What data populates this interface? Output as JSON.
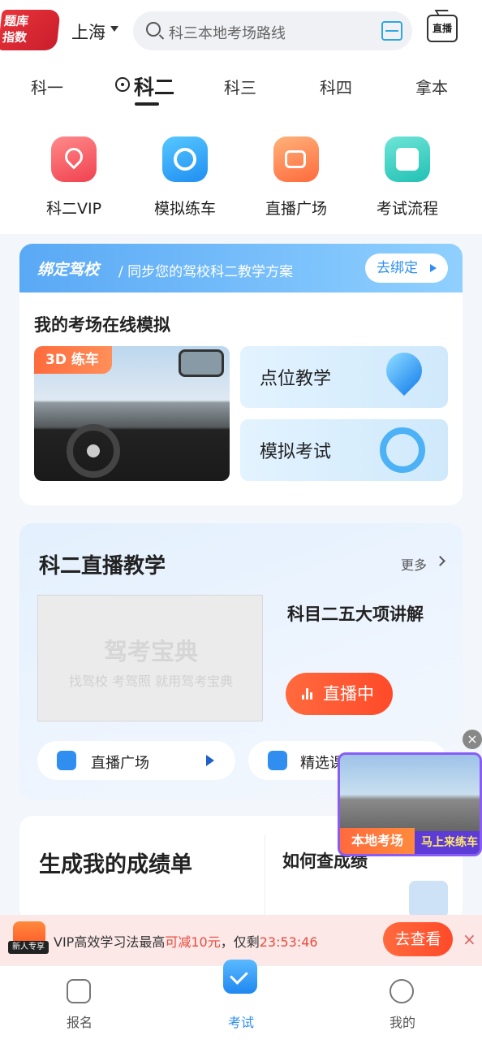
{
  "header": {
    "logo_line1": "题库",
    "logo_line2": "指数",
    "city": "上海",
    "search_placeholder": "科三本地考场路线",
    "live_icon_label": "直播"
  },
  "subject_tabs": [
    "科一",
    "科二",
    "科三",
    "科四",
    "拿本"
  ],
  "active_tab": "科二",
  "quick_entries": [
    {
      "label": "科二VIP",
      "icon": "vip-icon"
    },
    {
      "label": "模拟练车",
      "icon": "steering-wheel-3d-icon"
    },
    {
      "label": "直播广场",
      "icon": "video-camera-icon"
    },
    {
      "label": "考试流程",
      "icon": "document-icon"
    }
  ],
  "bind_school": {
    "title": "绑定驾校",
    "subtitle": "/ 同步您的驾校科二教学方案",
    "button": "去绑定"
  },
  "online_sim": {
    "title": "我的考场在线模拟",
    "image_tag": "3D 练车",
    "tiles": [
      "点位教学",
      "模拟考试"
    ]
  },
  "live_teaching": {
    "title": "科二直播教学",
    "more": "更多",
    "watermark_title": "驾考宝典",
    "watermark_sub": "找驾校 考驾照 就用驾考宝典",
    "course_title": "科目二五大项讲解",
    "live_button": "直播中",
    "pills": [
      "直播广场",
      "精选课"
    ]
  },
  "floating_ad": {
    "tag1": "本地考场",
    "tag2": "马上来练车",
    "close": "×"
  },
  "score_card": {
    "title": "生成我的成绩单",
    "question": "如何查成绩"
  },
  "promo": {
    "badge": "新人专享",
    "text_prefix": "VIP高效学习法最高",
    "discount": "可减10元",
    "text_mid": "，仅剩",
    "countdown": "23:53:46",
    "button": "去查看",
    "close": "×"
  },
  "bottom_nav": [
    {
      "label": "报名",
      "icon": "signup-icon"
    },
    {
      "label": "考试",
      "icon": "exam-check-icon"
    },
    {
      "label": "我的",
      "icon": "profile-icon"
    }
  ],
  "colors": {
    "accent_blue": "#2f8ef0",
    "accent_orange": "#ff5a2a",
    "brand_red": "#e8343a"
  }
}
